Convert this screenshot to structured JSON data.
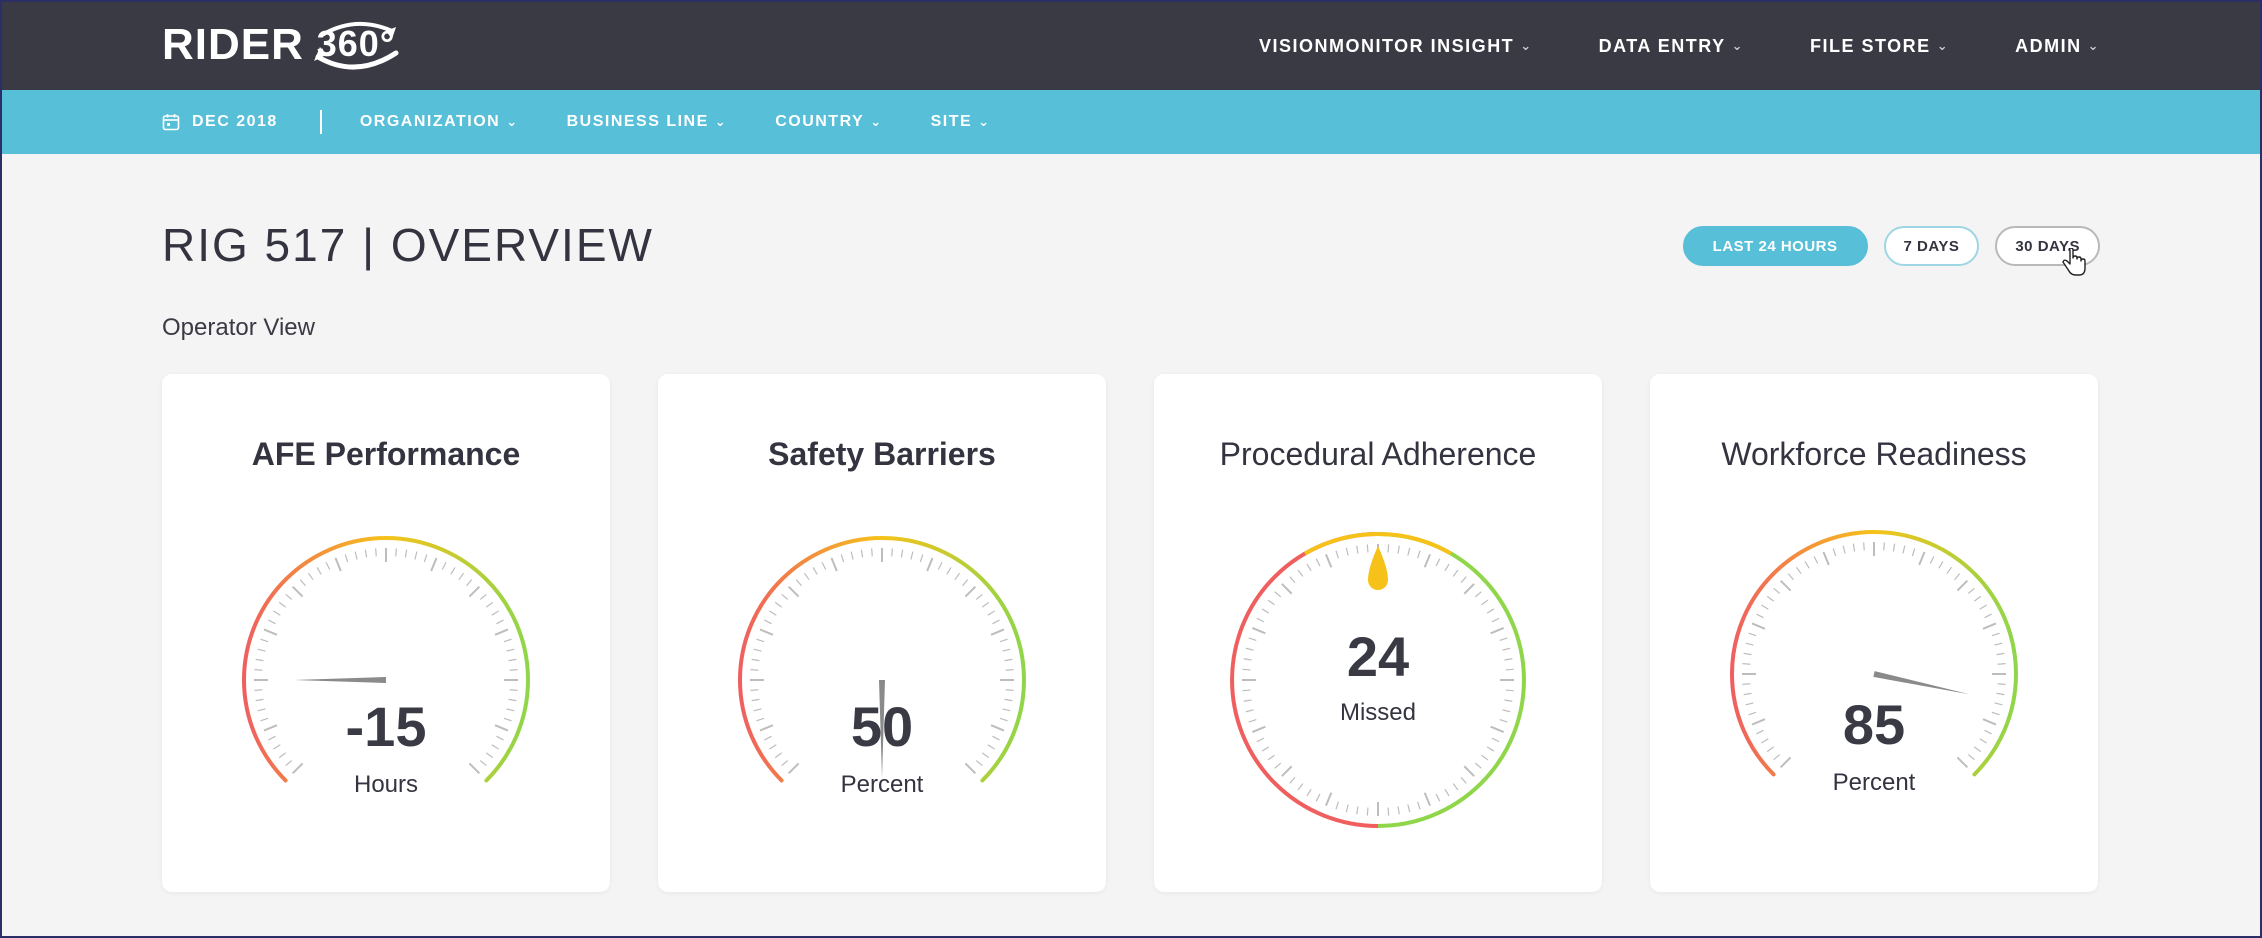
{
  "brand": {
    "name": "RIDER",
    "suffix": "360°"
  },
  "main_nav": [
    {
      "label": "VISIONMONITOR INSIGHT"
    },
    {
      "label": "DATA ENTRY"
    },
    {
      "label": "FILE STORE"
    },
    {
      "label": "ADMIN"
    }
  ],
  "sub_nav": {
    "date": "DEC 2018",
    "filters": [
      {
        "label": "ORGANIZATION"
      },
      {
        "label": "BUSINESS LINE"
      },
      {
        "label": "COUNTRY"
      },
      {
        "label": "SITE"
      }
    ]
  },
  "page": {
    "title": "RIG 517 | OVERVIEW",
    "subtitle": "Operator View"
  },
  "ranges": [
    {
      "label": "LAST 24 HOURS",
      "active": true
    },
    {
      "label": "7 DAYS",
      "active": false
    },
    {
      "label": "30 DAYS",
      "active": false
    }
  ],
  "gauges": [
    {
      "title": "AFE Performance",
      "value": "-15",
      "unit": "Hours"
    },
    {
      "title": "Safety Barriers",
      "value": "50",
      "unit": "Percent"
    },
    {
      "title": "Procedural Adherence",
      "value": "24",
      "unit": "Missed"
    },
    {
      "title": "Workforce Readiness",
      "value": "85",
      "unit": "Percent"
    }
  ],
  "colors": {
    "topbar": "#3a3a45",
    "subbar": "#57bfd7",
    "red": "#ef5f5f",
    "yellow": "#f6c21a",
    "green": "#8fd64a"
  },
  "icons": {
    "date": "calendar-icon",
    "dropdown": "chevron-down-icon",
    "cursor": "hand-pointer-icon"
  }
}
